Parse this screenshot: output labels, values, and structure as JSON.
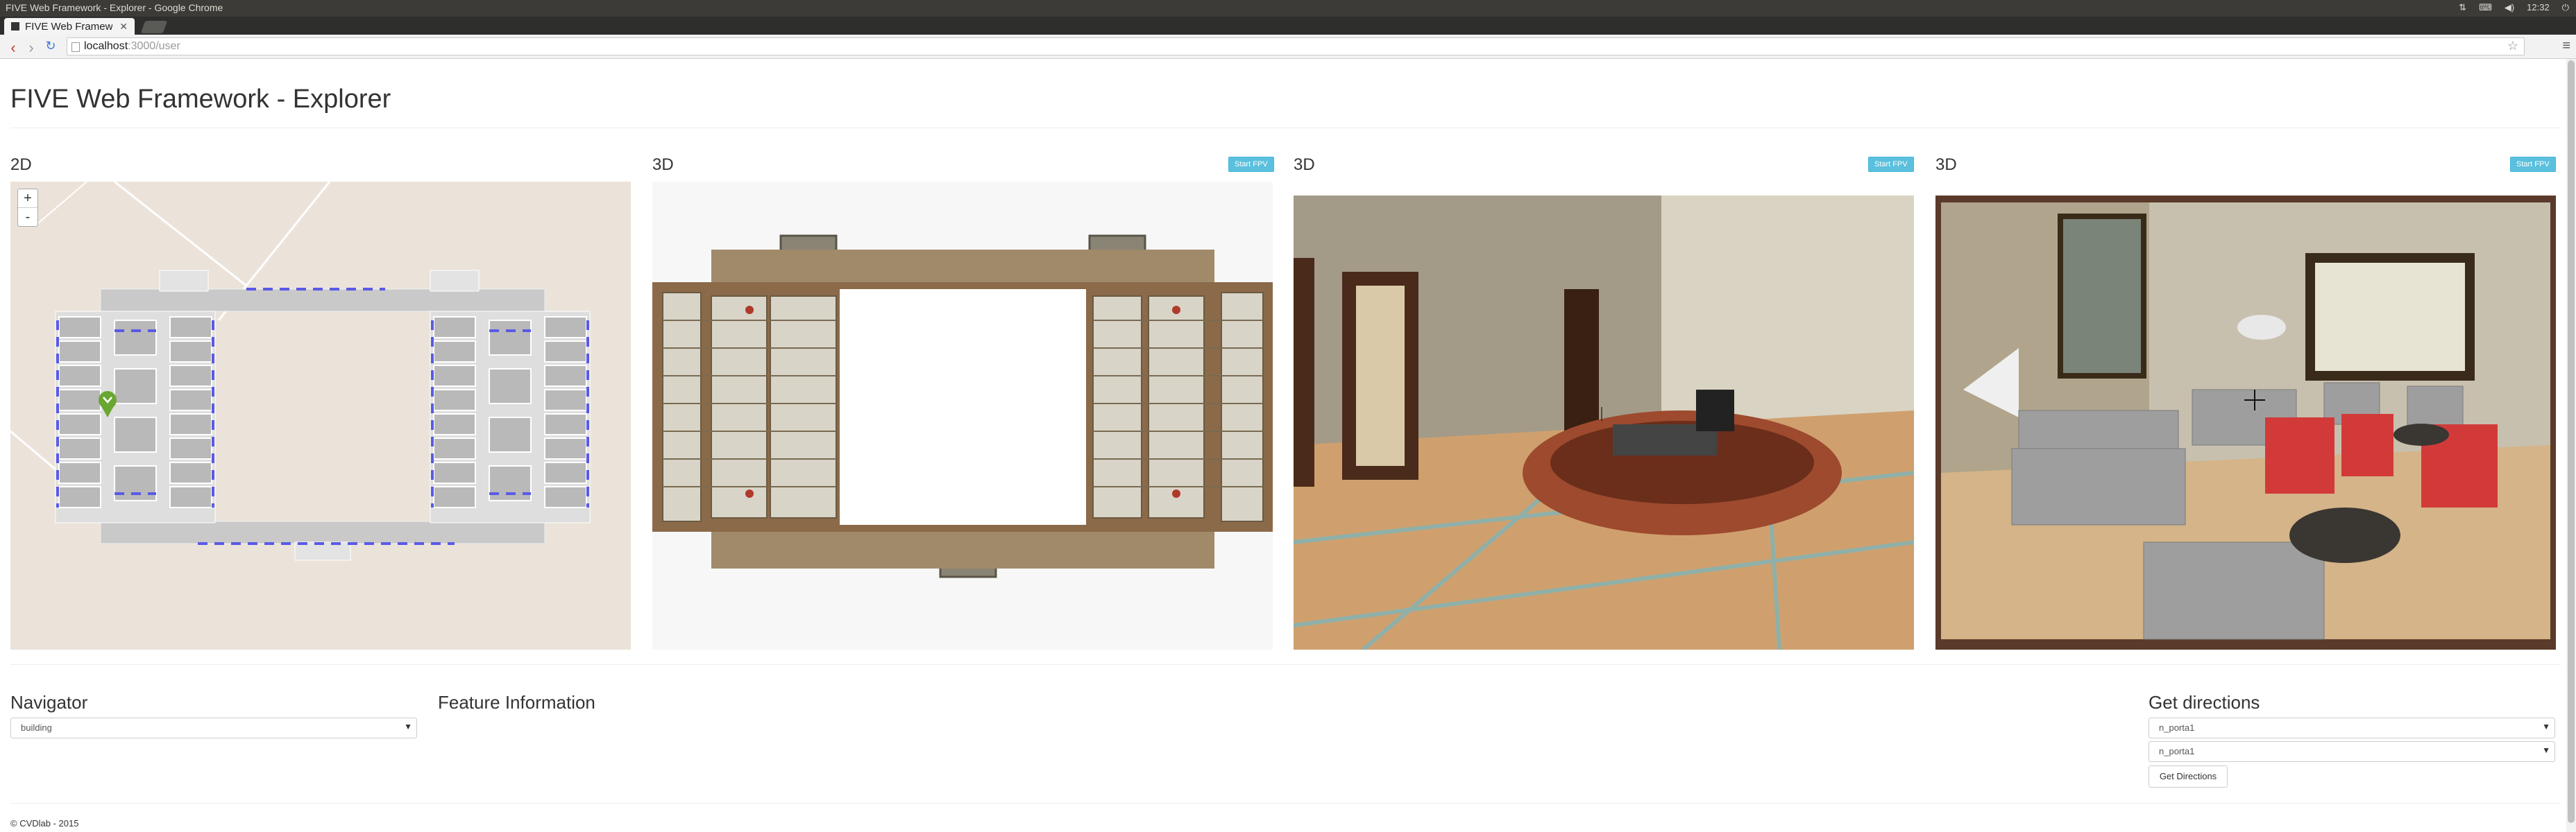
{
  "browser": {
    "window_title": "FIVE Web Framework - Explorer - Google Chrome",
    "tab_label": "FIVE Web Framewo",
    "url_host": "localhost",
    "url_path": ":3000/user",
    "clock": "12:32",
    "tray_icons": [
      "network-icon",
      "keyboard-icon",
      "volume-icon",
      "power-icon"
    ]
  },
  "page": {
    "title": "FIVE Web Framework - Explorer",
    "panels": [
      {
        "heading": "2D"
      },
      {
        "heading": "3D",
        "button": "Start FPV"
      },
      {
        "heading": "3D",
        "button": "Start FPV"
      },
      {
        "heading": "3D",
        "button": "Start FPV"
      }
    ],
    "map_zoom_in": "+",
    "map_zoom_out": "-"
  },
  "navigator": {
    "heading": "Navigator",
    "selected": "building"
  },
  "feature_info": {
    "heading": "Feature Information"
  },
  "directions": {
    "heading": "Get directions",
    "from": "n_porta1",
    "to": "n_porta1",
    "button": "Get Directions"
  },
  "footer": "© CVDlab - 2015",
  "colors": {
    "fpv_button": "#5bc0de",
    "map_background": "#ebe3da",
    "marker": "#6aa632"
  }
}
